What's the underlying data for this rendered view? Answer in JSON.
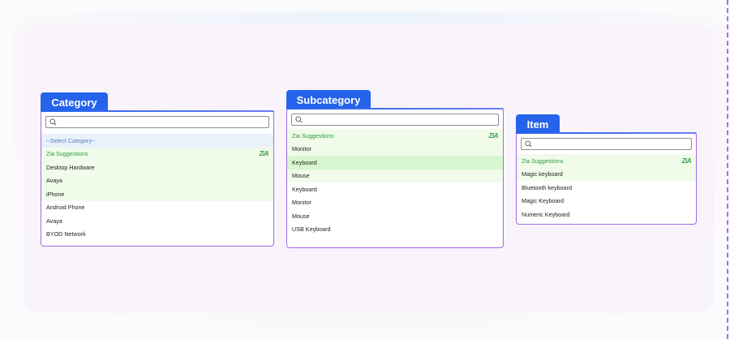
{
  "category": {
    "title": "Category",
    "search_placeholder": "",
    "items": [
      {
        "label": "--Select Category--",
        "style": "blue"
      },
      {
        "label": "Zia Suggestions",
        "style": "green",
        "zia": true
      },
      {
        "label": "Desktop Hardware",
        "style": "green"
      },
      {
        "label": "Avaya",
        "style": "green"
      },
      {
        "label": "iPhone",
        "style": "green"
      },
      {
        "label": "Android Phone",
        "style": "plain"
      },
      {
        "label": "Avaya",
        "style": "plain"
      },
      {
        "label": "BYOD Network",
        "style": "plain"
      }
    ]
  },
  "subcategory": {
    "title": "Subcategory",
    "search_placeholder": "",
    "items": [
      {
        "label": "Zia Suggestions",
        "style": "green",
        "zia": true
      },
      {
        "label": "Monitor",
        "style": "green"
      },
      {
        "label": "Keyboard",
        "style": "sel-green"
      },
      {
        "label": "Mouse",
        "style": "green"
      },
      {
        "label": "Keyboard",
        "style": "plain"
      },
      {
        "label": "Monitor",
        "style": "plain"
      },
      {
        "label": "Mouse",
        "style": "plain"
      },
      {
        "label": "USB Keyboard",
        "style": "plain"
      }
    ]
  },
  "item": {
    "title": "Item",
    "search_placeholder": "",
    "items": [
      {
        "label": "Zia Suggestions",
        "style": "green",
        "zia": true
      },
      {
        "label": "Magic keyboard",
        "style": "green"
      },
      {
        "label": "Bluetooth keyboard",
        "style": "plain"
      },
      {
        "label": "Magic Keyboard",
        "style": "plain"
      },
      {
        "label": "Numeric Keyboard",
        "style": "plain"
      }
    ]
  },
  "zia_badge": "ZiA",
  "colors": {
    "tab_blue": "#2563eb",
    "border_purple": "#a06ae8",
    "suggestion_green_bg": "#f0fbe9",
    "selected_green_bg": "#d6f7cf",
    "zia_green": "#2e9a3b"
  },
  "icons": {
    "search": "search-icon",
    "zia": "zia-logo-icon"
  }
}
